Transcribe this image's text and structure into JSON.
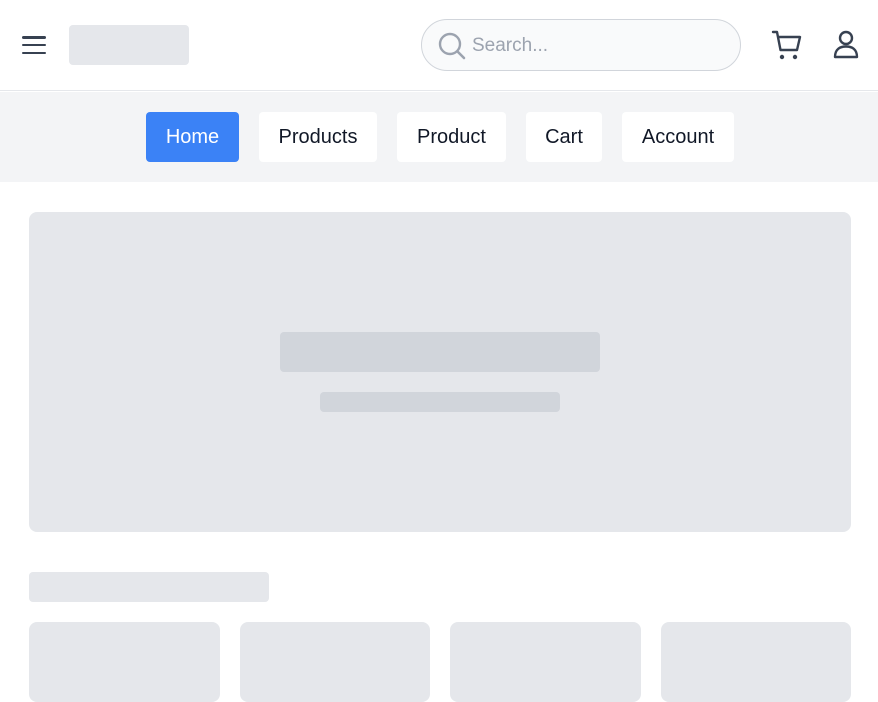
{
  "header": {
    "search": {
      "placeholder": "Search...",
      "value": ""
    },
    "icons": {
      "menu": "hamburger-menu-icon",
      "search": "search-icon",
      "cart": "shopping-cart-icon",
      "user": "user-icon"
    }
  },
  "nav": {
    "tabs": [
      {
        "label": "Home",
        "active": true
      },
      {
        "label": "Products",
        "active": false
      },
      {
        "label": "Product",
        "active": false
      },
      {
        "label": "Cart",
        "active": false
      },
      {
        "label": "Account",
        "active": false
      }
    ]
  },
  "colors": {
    "accent": "#3b82f6",
    "skeleton": "#e5e7eb",
    "skeleton_dark": "#d1d5db",
    "nav_background": "#f3f4f6",
    "icon": "#374151"
  }
}
